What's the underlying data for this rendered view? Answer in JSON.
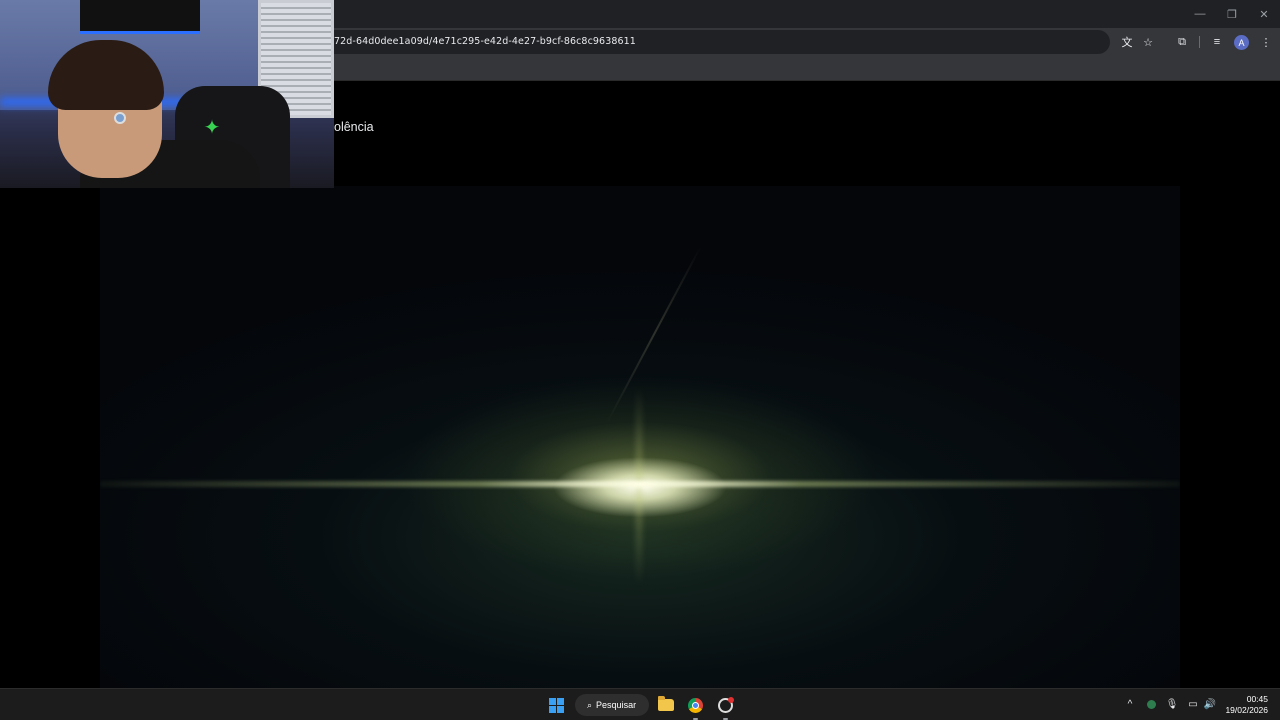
{
  "browser": {
    "url": "72d-64d0dee1a09d/4e71c295-e42d-4e27-b9cf-86c8c9638611",
    "window_controls": {
      "minimize_icon": "—",
      "restore_icon": "❐",
      "close_icon": "✕"
    },
    "toolbar_icons": {
      "translate": "文",
      "bookmark_star": "☆",
      "extensions": "⧉",
      "media": "≡",
      "menu": "⋮"
    },
    "profile_initial": "A"
  },
  "page": {
    "title_fragment": "olência"
  },
  "taskbar": {
    "search_label": "Pesquisar",
    "search_icon": "⌕",
    "tray": {
      "chevron": "^",
      "mic": "🎙",
      "display": "▭",
      "volume": "🔊"
    },
    "clock_time": "00:45",
    "clock_date": "19/02/2026"
  }
}
